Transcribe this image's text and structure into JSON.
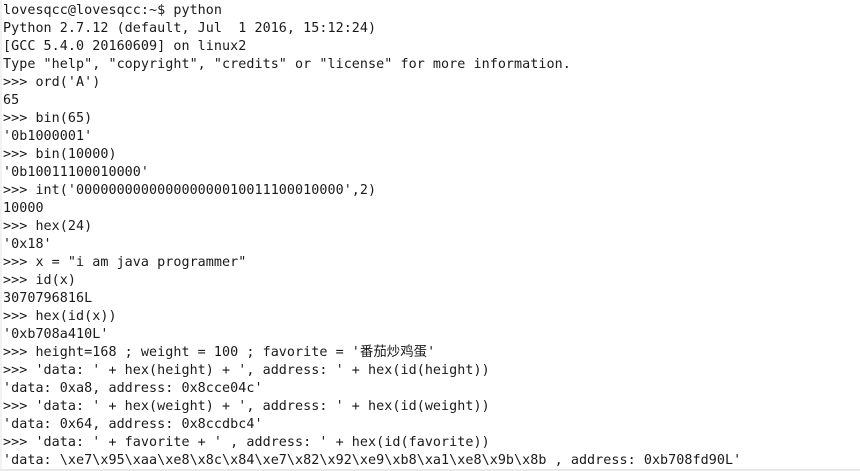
{
  "terminal": {
    "lines": [
      "lovesqcc@lovesqcc:~$ python",
      "Python 2.7.12 (default, Jul  1 2016, 15:12:24)",
      "[GCC 5.4.0 20160609] on linux2",
      "Type \"help\", \"copyright\", \"credits\" or \"license\" for more information.",
      ">>> ord('A')",
      "65",
      ">>> bin(65)",
      "'0b1000001'",
      ">>> bin(10000)",
      "'0b10011100010000'",
      ">>> int('000000000000000000010011100010000',2)",
      "10000",
      ">>> hex(24)",
      "'0x18'",
      ">>> x = \"i am java programmer\"",
      ">>> id(x)",
      "3070796816L",
      ">>> hex(id(x))",
      "'0xb708a410L'",
      ">>> height=168 ; weight = 100 ; favorite = '番茄炒鸡蛋'",
      ">>> 'data: ' + hex(height) + ', address: ' + hex(id(height))",
      "'data: 0xa8, address: 0x8cce04c'",
      ">>> 'data: ' + hex(weight) + ', address: ' + hex(id(weight))",
      "'data: 0x64, address: 0x8ccdbc4'",
      ">>> 'data: ' + favorite + ' , address: ' + hex(id(favorite))",
      "'data: \\xe7\\x95\\xaa\\xe8\\x8c\\x84\\xe7\\x82\\x92\\xe9\\xb8\\xa1\\xe8\\x9b\\x8b , address: 0xb708fd90L'"
    ]
  }
}
